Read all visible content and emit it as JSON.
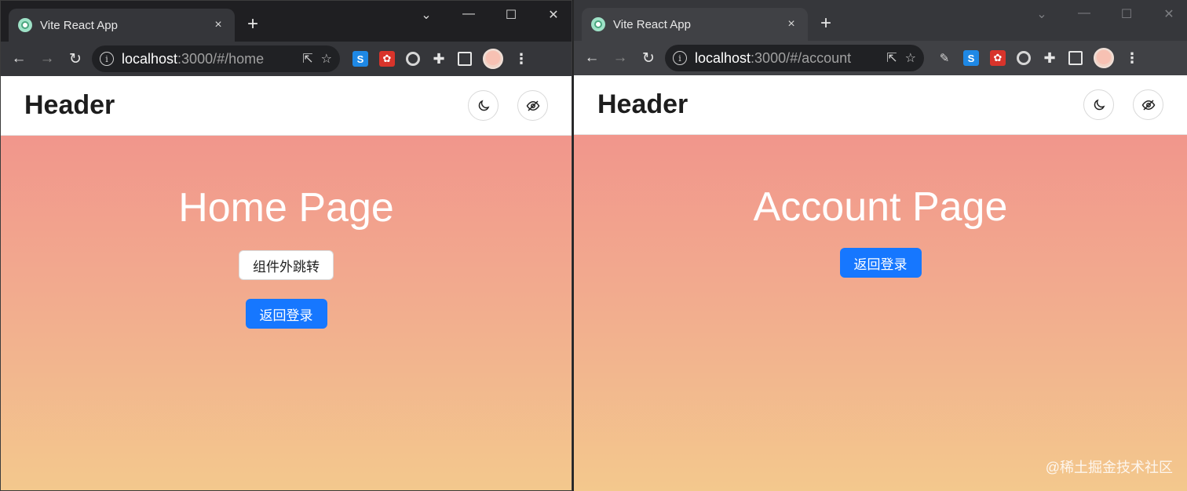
{
  "left_window": {
    "tab": {
      "title": "Vite React App",
      "close": "×"
    },
    "new_tab": "+",
    "window_controls": {
      "dropdown": "⌄",
      "minimize": "—",
      "maximize": "☐",
      "close": "✕"
    },
    "url": {
      "host": "localhost",
      "path": ":3000/#/home"
    },
    "header": {
      "title": "Header"
    },
    "content": {
      "title": "Home Page",
      "button_outside": "组件外跳转",
      "button_back": "返回登录"
    }
  },
  "right_window": {
    "tab": {
      "title": "Vite React App",
      "close": "×"
    },
    "new_tab": "+",
    "window_controls": {
      "dropdown": "⌄",
      "minimize": "—",
      "maximize": "☐",
      "close": "✕"
    },
    "url": {
      "host": "localhost",
      "path": ":3000/#/account"
    },
    "header": {
      "title": "Header"
    },
    "content": {
      "title": "Account Page",
      "button_back": "返回登录"
    }
  },
  "toolbar_icons": [
    "back-icon",
    "forward-icon",
    "reload-icon",
    "info-icon",
    "share-icon",
    "star-icon",
    "extension-s-icon",
    "extension-red-icon",
    "extension-ring-icon",
    "puzzle-icon",
    "side-panel-icon",
    "avatar",
    "menu-icon"
  ],
  "header_icons": [
    "moon-icon",
    "eye-slash-icon"
  ],
  "watermark": "@稀土掘金技术社区",
  "colors": {
    "primary": "#1677ff",
    "gradient_top": "#f1968c",
    "gradient_bottom": "#f3c88d"
  }
}
